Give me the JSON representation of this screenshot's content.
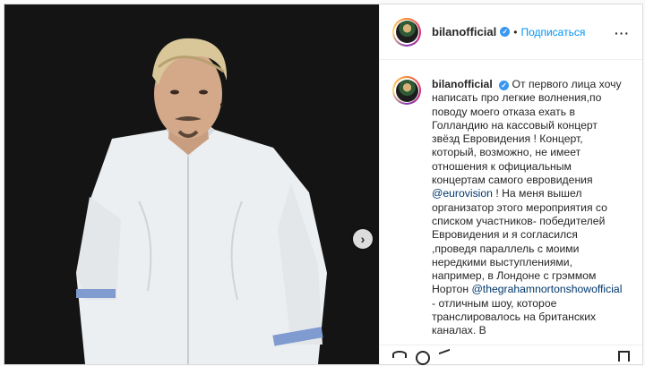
{
  "post": {
    "header": {
      "username": "bilanofficial",
      "separator": "•",
      "follow_label": "Подписаться",
      "more_icon": "more-horizontal-icon"
    },
    "caption": {
      "username": "bilanofficial",
      "text_part1": "От первого лица хочу написать про легкие волнения,по поводу моего отказа ехать в Голландию на кассовый концерт звёзд Евровидения ! Концерт, который, возможно, не имеет отношения к официальным концертам самого евровидения ",
      "mention1": "@eurovision",
      "text_part2": " ! На меня вышел организатор этого мероприятия со списком участников- победителей Евровидения и я согласился ,проведя параллель с моими нередкими выступлениями, например, в Лондоне с грэммом Нортон ",
      "mention2": "@thegrahamnortonshowofficial",
      "text_part3": " - отличным шоу, которое транслировалось на британских каналах. В"
    },
    "carousel": {
      "next_icon": "chevron-right-icon",
      "next_label": "›"
    }
  },
  "colors": {
    "link_blue": "#0095f6",
    "verified_blue": "#3897f0",
    "mention_blue": "#00376b"
  }
}
